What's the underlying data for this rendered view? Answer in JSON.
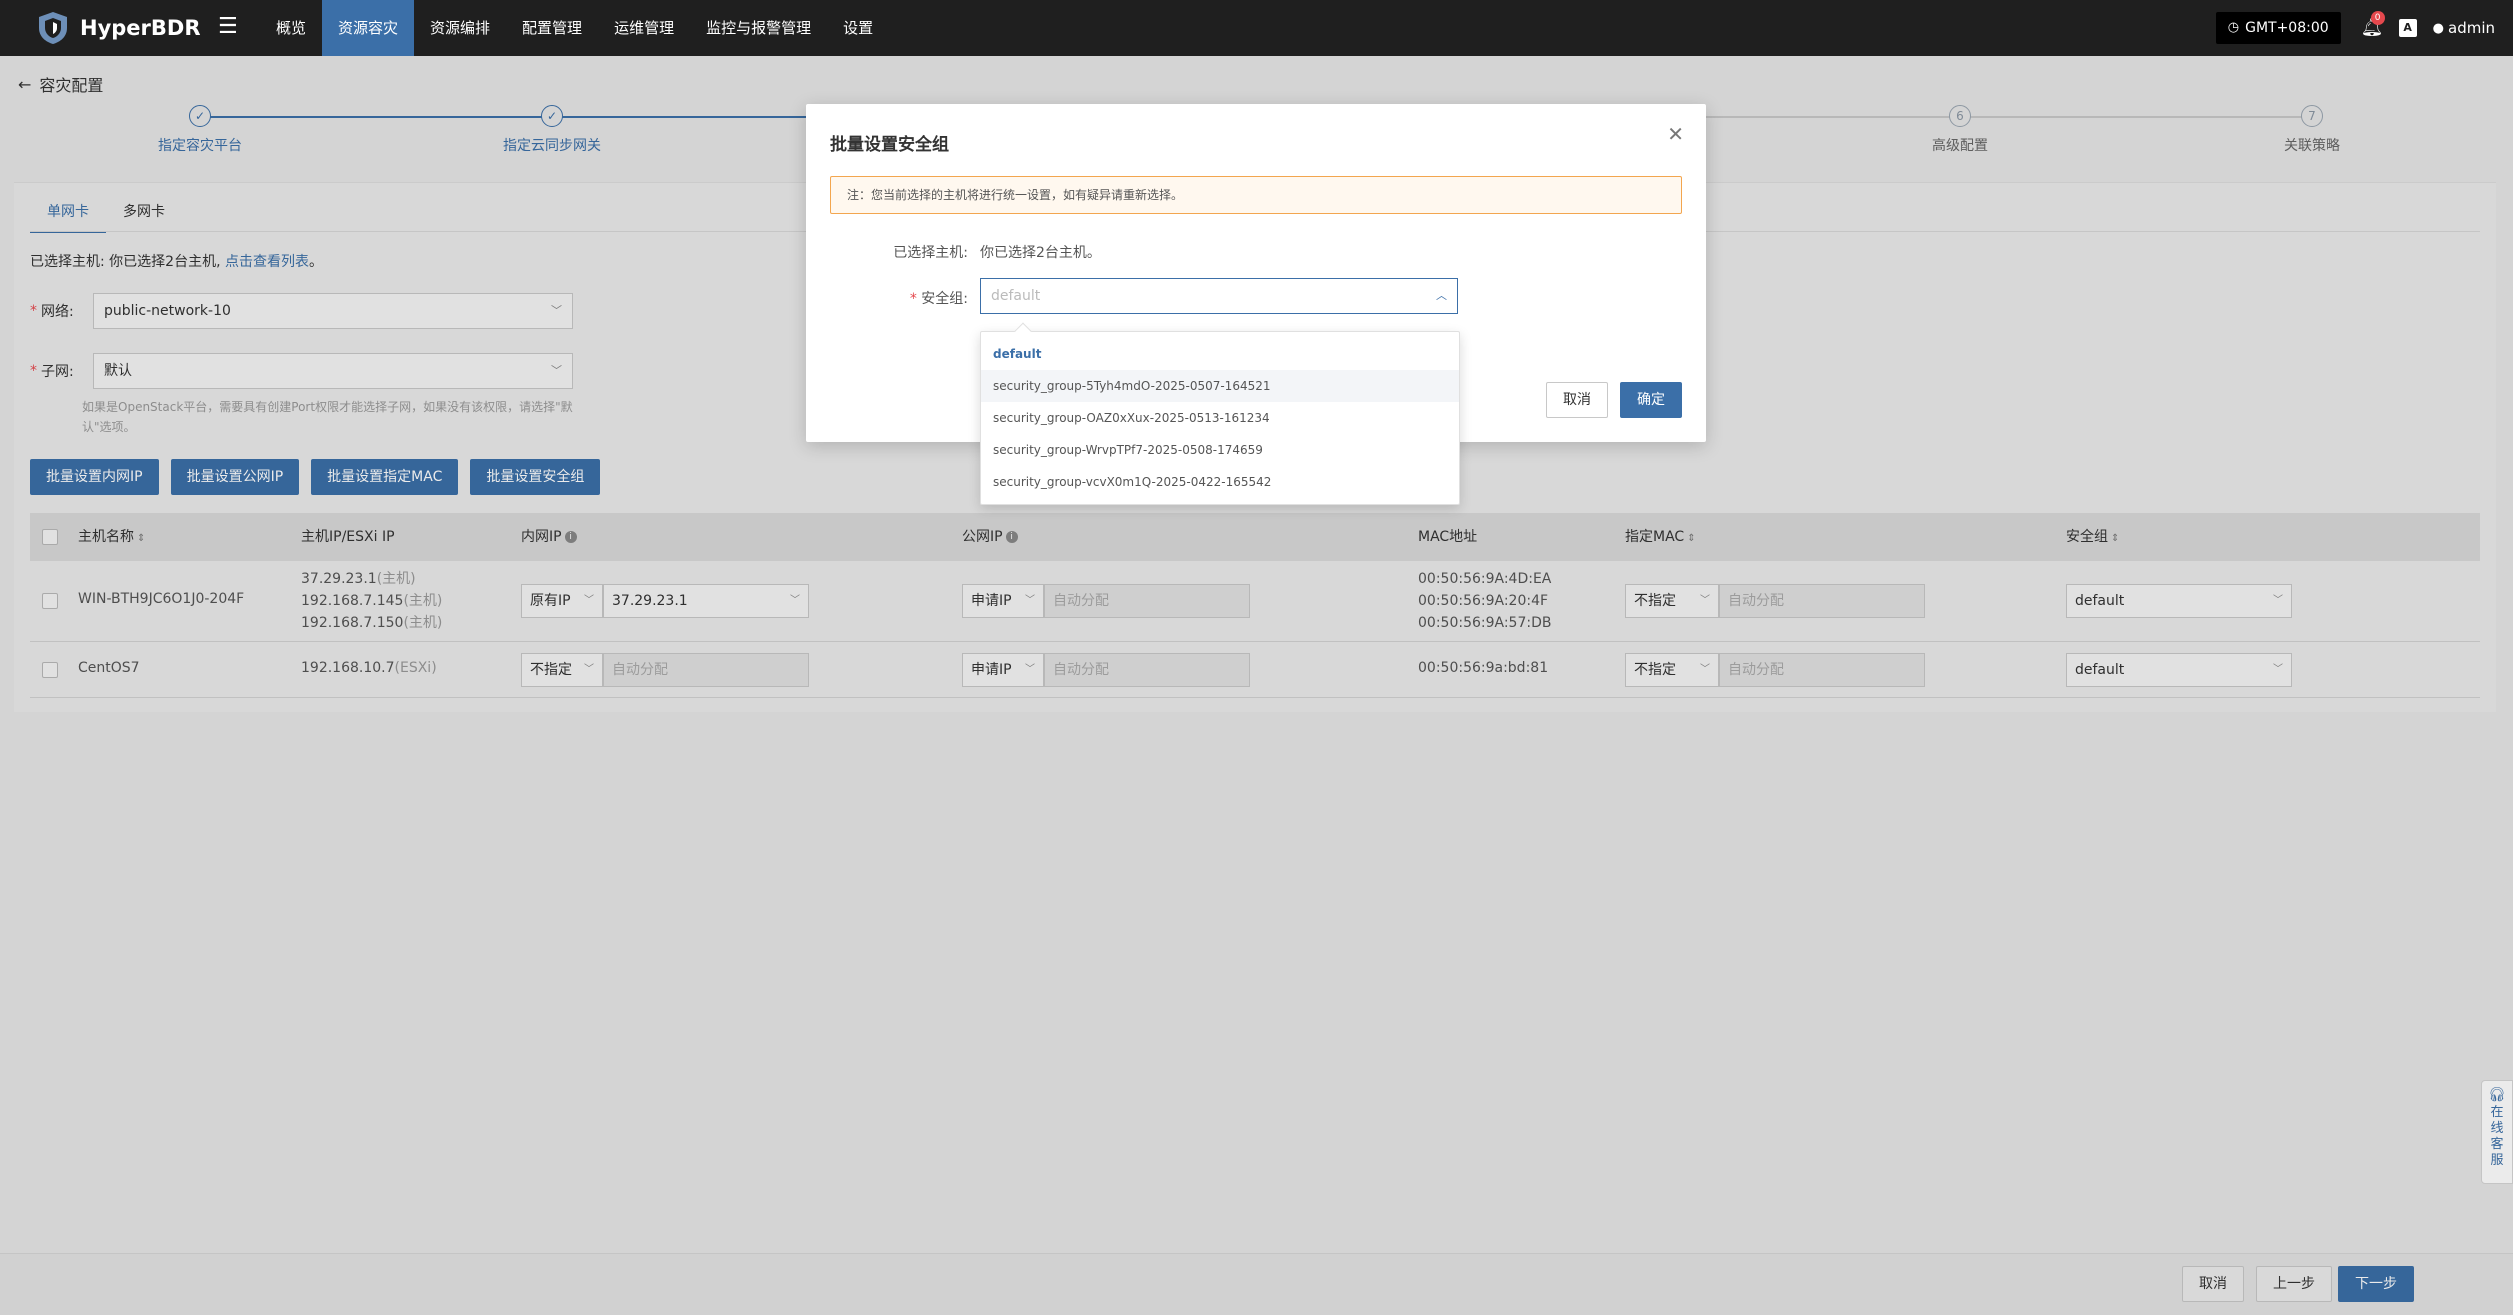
{
  "app": {
    "name": "HyperBDR",
    "nav": [
      "概览",
      "资源容灾",
      "资源编排",
      "配置管理",
      "运维管理",
      "监控与报警管理",
      "设置"
    ],
    "active_nav": "资源容灾",
    "timezone": "GMT+08:00",
    "notification_count": "0",
    "lang_icon_text": "A",
    "user": "admin"
  },
  "page": {
    "back_label": "容灾配置",
    "steps": [
      {
        "num": "✓",
        "label": "指定容灾平台",
        "state": "done"
      },
      {
        "num": "✓",
        "label": "指定云同步网关",
        "state": "done"
      },
      {
        "num": "6",
        "label": "高级配置",
        "state": "todo"
      },
      {
        "num": "7",
        "label": "关联策略",
        "state": "todo"
      }
    ],
    "tabs": [
      "单网卡",
      "多网卡"
    ],
    "selected_info_prefix": "已选择主机:  你已选择2台主机,",
    "selected_info_link": "点击查看列表",
    "selected_info_suffix": "。",
    "network_label": "网络:",
    "network_value": "public-network-10",
    "subnet_label": "子网:",
    "subnet_value": "默认",
    "hint": "如果是OpenStack平台，需要具有创建Port权限才能选择子网，如果没有该权限，请选择\"默认\"选项。",
    "batch_buttons": [
      "批量设置内网IP",
      "批量设置公网IP",
      "批量设置指定MAC",
      "批量设置安全组"
    ],
    "table": {
      "headers": [
        "主机名称",
        "主机IP/ESXi IP",
        "内网IP",
        "公网IP",
        "MAC地址",
        "指定MAC",
        "安全组"
      ],
      "rows": [
        {
          "name": "WIN-BTH9JC6O1J0-204F",
          "ips": [
            "37.29.23.1",
            "192.168.7.145",
            "192.168.7.150"
          ],
          "ip_tags": [
            "(主机)",
            "(主机)",
            "(主机)"
          ],
          "inner_mode": "原有IP",
          "inner_value": "37.29.23.1",
          "public_mode": "申请IP",
          "public_placeholder": "自动分配",
          "macs": [
            "00:50:56:9A:4D:EA",
            "00:50:56:9A:20:4F",
            "00:50:56:9A:57:DB"
          ],
          "mac_mode": "不指定",
          "mac_placeholder": "自动分配",
          "sg": "default"
        },
        {
          "name": "CentOS7",
          "ips": [
            "192.168.10.7"
          ],
          "ip_tags": [
            "(ESXi)"
          ],
          "inner_mode": "不指定",
          "inner_value": "自动分配",
          "public_mode": "申请IP",
          "public_placeholder": "自动分配",
          "macs": [
            "00:50:56:9a:bd:81"
          ],
          "mac_mode": "不指定",
          "mac_placeholder": "自动分配",
          "sg": "default"
        }
      ]
    },
    "footer": {
      "cancel": "取消",
      "prev": "上一步",
      "next": "下一步"
    },
    "support": [
      "在",
      "线",
      "客",
      "服"
    ]
  },
  "modal": {
    "title": "批量设置安全组",
    "alert": "注：您当前选择的主机将进行统一设置，如有疑异请重新选择。",
    "selected_label": "已选择主机:",
    "selected_value": "你已选择2台主机。",
    "sg_label": "安全组:",
    "sg_placeholder": "default",
    "cancel": "取消",
    "ok": "确定",
    "options": [
      "default",
      "security_group-5Tyh4mdO-2025-0507-164521",
      "security_group-OAZ0xXux-2025-0513-161234",
      "security_group-WrvpTPf7-2025-0508-174659",
      "security_group-vcvX0m1Q-2025-0422-165542"
    ]
  },
  "colors": {
    "accent": "#3b6fa8",
    "topbar": "#1f1f1f",
    "warning_border": "#f3a64f",
    "danger": "#e5484d"
  },
  "icons": [
    "shield-logo-icon",
    "hamburger-icon",
    "clock-icon",
    "bell-icon",
    "translate-icon",
    "user-icon",
    "back-arrow-icon",
    "close-icon",
    "chevron-down-icon",
    "chevron-up-icon",
    "sort-icon",
    "info-icon",
    "headset-icon"
  ]
}
